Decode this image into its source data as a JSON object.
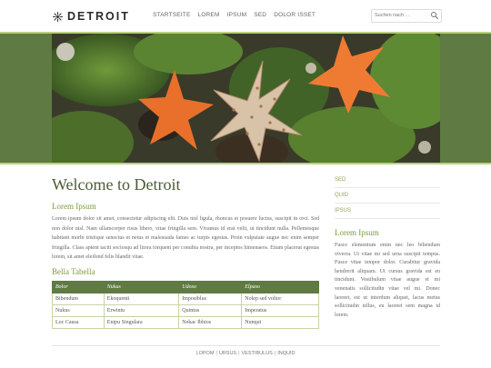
{
  "logo": {
    "text": "DETROIT"
  },
  "nav": {
    "items": [
      {
        "label": "STARTSEITE"
      },
      {
        "label": "LOREM"
      },
      {
        "label": "IPSUM"
      },
      {
        "label": "SED"
      },
      {
        "label": "DOLOR ISSET"
      }
    ]
  },
  "search": {
    "placeholder": "Suchen nach ..."
  },
  "banner": {
    "alt": "Starfish on moss"
  },
  "main": {
    "title": "Welcome to Detroit",
    "section1": {
      "heading": "Lorem Ipsum",
      "text": "Lorem ipsum dolor sit amet, consectetur adipiscing elit. Duis nisl ligula, rhoncus et posuere luctus, suscipit in orci. Sed non dolor nisl. Nam ullamcorper risus libero, vitae fringilla sem. Vivamus id erat velit, ut tincidunt nulla. Pellentesque habitant morbi tristique senectus et netus et malesuada fames ac turpis egestas. Proin vulputate augue nec enim semper fringilla. Class aptent taciti sociosqu ad litora torquent per conubia nostra, per inceptos himenaeos. Etiam placerat egestas lorem, sit amet eleifend felis blandit vitae."
    },
    "section2": {
      "heading": "Bella Tabella",
      "table": {
        "headers": [
          "Bolor",
          "Nukus",
          "Udoso",
          "Elpaso"
        ],
        "rows": [
          [
            "Bibendum",
            "Ekoquenti",
            "Imposiblus",
            "Nolep sed voltor"
          ],
          [
            "Nukus",
            "Erwintu",
            "Quintus",
            "Imperatus"
          ],
          [
            "Loc Causa",
            "Enipu Singulara",
            "Nekac Ibhios",
            "Nunqui"
          ]
        ]
      }
    }
  },
  "sidebar": {
    "links": [
      {
        "label": "SED"
      },
      {
        "label": "QUID"
      },
      {
        "label": "IPSUS"
      }
    ],
    "heading": "Lorem Ipsum",
    "text": "Fusce elementum enim nec leo bibendum viverra. Ut vitae mi sed urna suscipit tempus. Fusce vitae tempor dolor. Curabitur gravida hendrerit aliquam. Ut cursus gravida est eu tincidunt. Vestibulum vitae augue et mi venenatis sollicitudin vitae vel mi. Donec laoreet, est ut interdum aliquet, lacus metus sollicitudin tellus, eu laoreet sem magna id lorem."
  },
  "footer": {
    "links": [
      {
        "label": "LOPOM"
      },
      {
        "label": "URSUS"
      },
      {
        "label": "VESTIBULUS"
      },
      {
        "label": "INQUID"
      }
    ],
    "separator": "|"
  },
  "colors": {
    "accent": "#5f7a43",
    "accent_light": "#b9cf7e",
    "heading_green": "#7c9a3d",
    "title_green": "#4a5d35"
  }
}
